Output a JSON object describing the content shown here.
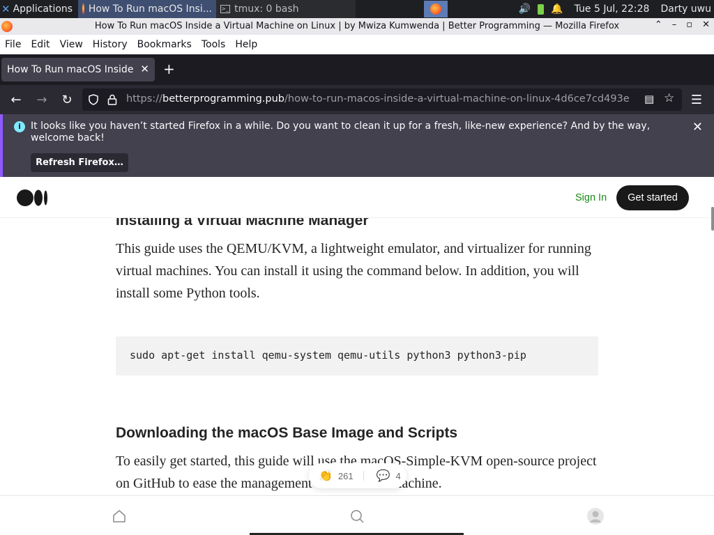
{
  "panel": {
    "apps_label": "Applications",
    "task_firefox": "How To Run macOS Insi...",
    "task_terminal": "tmux: 0 bash",
    "clock": "Tue  5 Jul, 22:28",
    "user": "Darty uwu"
  },
  "window": {
    "title": "How To Run macOS Inside a Virtual Machine on Linux | by Mwiza Kumwenda | Better Programming — Mozilla Firefox"
  },
  "menubar": {
    "file": "File",
    "edit": "Edit",
    "view": "View",
    "history": "History",
    "bookmarks": "Bookmarks",
    "tools": "Tools",
    "help": "Help"
  },
  "tab": {
    "label": "How To Run macOS Inside a Virtual Machine on Linux"
  },
  "url": {
    "scheme": "https://",
    "domain": "betterprogramming.pub",
    "path": "/how-to-run-macos-inside-a-virtual-machine-on-linux-4d6ce7cd493e"
  },
  "notification": {
    "message": "It looks like you haven’t started Firefox in a while. Do you want to clean it up for a fresh, like-new experience? And by the way, welcome back!",
    "button": "Refresh Firefox…"
  },
  "medium": {
    "sign_in": "Sign In",
    "get_started": "Get started"
  },
  "article": {
    "heading1": "Installing a Virtual Machine Manager",
    "para1": "This guide uses the QEMU/KVM, a lightweight emulator, and virtualizer for running virtual machines. You can install it using the command below. In addition, you will install some Python tools.",
    "code": "sudo apt-get install qemu-system qemu-utils python3 python3-pip",
    "heading2": "Downloading the macOS Base Image and Scripts",
    "para2": "To easily get started, this guide will use the macOS-Simple-KVM open-source project on GitHub to ease the management of the virtual machine."
  },
  "reactions": {
    "claps": "261",
    "comments": "4"
  },
  "colors": {
    "accent_green": "#1a8917",
    "notification_accent": "#9059ff"
  }
}
